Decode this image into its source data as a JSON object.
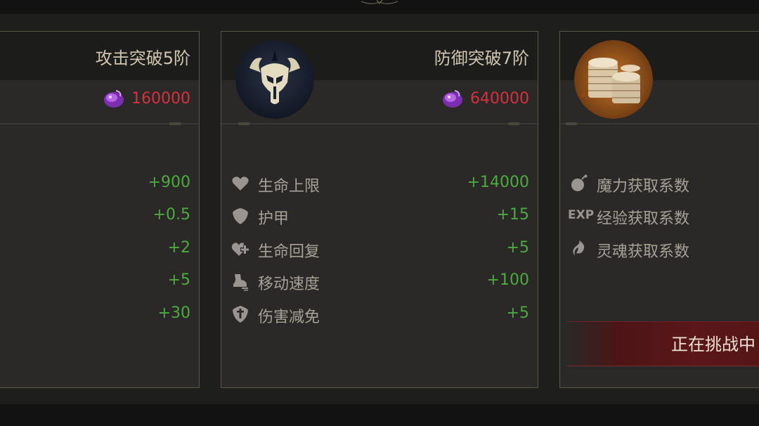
{
  "cards": [
    {
      "title": "攻击突破5阶",
      "cost": "160000",
      "stats": [
        {
          "value": "+900"
        },
        {
          "value": "+0.5"
        },
        {
          "value": "+2"
        },
        {
          "value": "+5"
        },
        {
          "value": "+30"
        }
      ]
    },
    {
      "title": "防御突破7阶",
      "emblem_icon": "horned-helmet-icon",
      "cost": "640000",
      "stats": [
        {
          "icon": "heart-icon",
          "label": "生命上限",
          "value": "+14000"
        },
        {
          "icon": "armor-shield-icon",
          "label": "护甲",
          "value": "+15"
        },
        {
          "icon": "heart-plus-icon",
          "label": "生命回复",
          "value": "+5"
        },
        {
          "icon": "running-boot-icon",
          "label": "移动速度",
          "value": "+100"
        },
        {
          "icon": "sword-shield-icon",
          "label": "伤害减免",
          "value": "+5"
        }
      ]
    },
    {
      "emblem_icon": "gold-coins-icon",
      "stats": [
        {
          "icon": "mana-bomb-icon",
          "label": "魔力获取系数"
        },
        {
          "icon_text": "EXP",
          "label": "经验获取系数"
        },
        {
          "icon": "soul-swirl-icon",
          "label": "灵魂获取系数"
        }
      ],
      "status_banner": "正在挑战中"
    }
  ],
  "colors": {
    "background": "#1e1e1d",
    "card": "#2a2927",
    "card_border": "#5a5648",
    "title": "#cfc5b0",
    "cost": "#d6303f",
    "stat_value": "#4bab3e",
    "stat_label": "#a6a097",
    "banner": "#5b1719"
  }
}
